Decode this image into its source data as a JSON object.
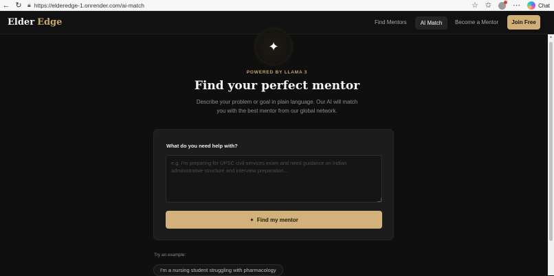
{
  "browser": {
    "url": "https://elderedge-1.onrender.com/ai-match",
    "chat_label": "Chat"
  },
  "header": {
    "logo_part1": "Elder",
    "logo_part2": "Edge",
    "nav": [
      "Find Mentors",
      "AI Match",
      "Become a Mentor"
    ],
    "join_label": "Join Free"
  },
  "hero": {
    "icon": "sparkle-icon",
    "powered": "POWERED BY LLAMA 3",
    "title": "Find your perfect mentor",
    "subtitle": "Describe your problem or goal in plain language. Our AI will match you with the best mentor from our global network."
  },
  "form": {
    "label": "What do you need help with?",
    "value": "",
    "placeholder": "e.g. I'm preparing for UPSC civil services exam and need guidance on Indian administrative structure and interview preparation...",
    "button_icon": "✦",
    "button_label": "Find my mentor"
  },
  "examples": {
    "label": "Try an example:",
    "items": [
      "I'm a nursing student struggling with pharmacology"
    ]
  },
  "colors": {
    "accent": "#c9a86b",
    "button": "#d2b27a",
    "background": "#0f0f0f"
  }
}
